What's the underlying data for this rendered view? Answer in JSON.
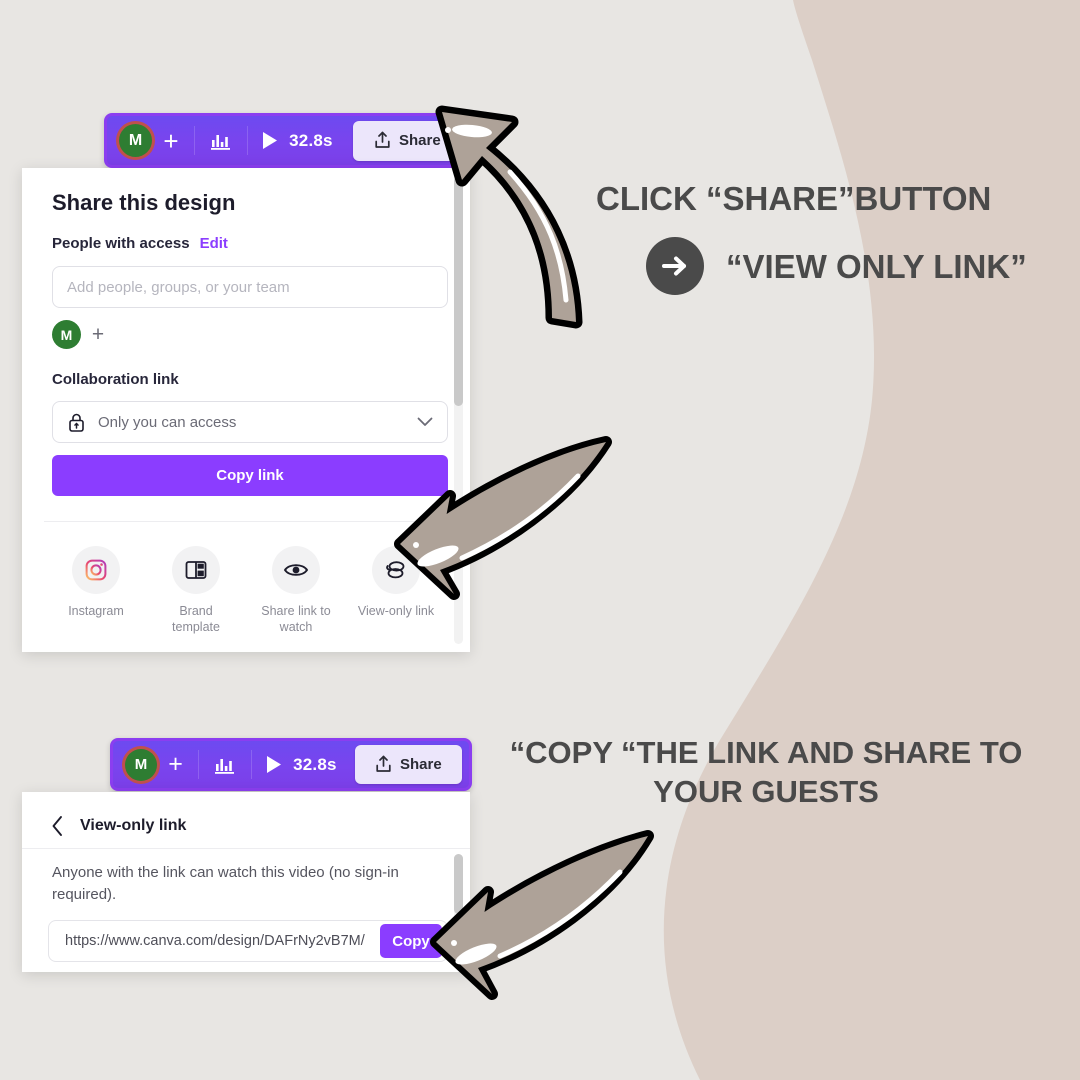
{
  "canvas": {
    "background_color": "#e8e6e3",
    "blob_color": "#dccfc7"
  },
  "toolbar_top": {
    "avatar_initial": "M",
    "add_label": "+",
    "chart_icon": "bar-chart-icon",
    "play_icon": "play-icon",
    "duration": "32.8s",
    "share_label": "Share",
    "share_icon": "upload-share-icon"
  },
  "toolbar_bottom": {
    "avatar_initial": "M",
    "add_label": "+",
    "chart_icon": "bar-chart-icon",
    "play_icon": "play-icon",
    "duration": "32.8s",
    "share_label": "Share",
    "share_icon": "upload-share-icon"
  },
  "share_dialog": {
    "title": "Share this design",
    "people_label": "People with access",
    "edit_label": "Edit",
    "add_people_placeholder": "Add people, groups, or your team",
    "member_initial": "M",
    "add_member_label": "+",
    "collaboration_label": "Collaboration link",
    "access_value": "Only you can access",
    "access_icon": "lock-icon",
    "chevron_icon": "chevron-down-icon",
    "copy_link_label": "Copy link",
    "share_options": [
      {
        "label": "Instagram",
        "icon": "instagram-icon"
      },
      {
        "label": "Brand template",
        "icon": "brand-template-icon"
      },
      {
        "label": "Share link to watch",
        "icon": "eye-icon"
      },
      {
        "label": "View-only link",
        "icon": "link-icon"
      }
    ]
  },
  "view_only_panel": {
    "back_icon": "chevron-left-icon",
    "title": "View-only link",
    "description": "Anyone with the link can watch this video (no sign-in required).",
    "url": "https://www.canva.com/design/DAFrNy2vB7M/",
    "copy_label": "Copy"
  },
  "callouts": {
    "first": {
      "line1": "CLICK “SHARE”BUTTON",
      "arrow_icon": "arrow-right-circle-icon",
      "line2": "“VIEW ONLY LINK”"
    },
    "second": {
      "line1": "“COPY “THE LINK AND SHARE TO",
      "line2": "YOUR GUESTS"
    }
  },
  "decorative_arrows": [
    {
      "name": "curved-arrow-to-share-button"
    },
    {
      "name": "curved-arrow-to-view-only-link"
    },
    {
      "name": "curved-arrow-to-copy-button"
    }
  ]
}
